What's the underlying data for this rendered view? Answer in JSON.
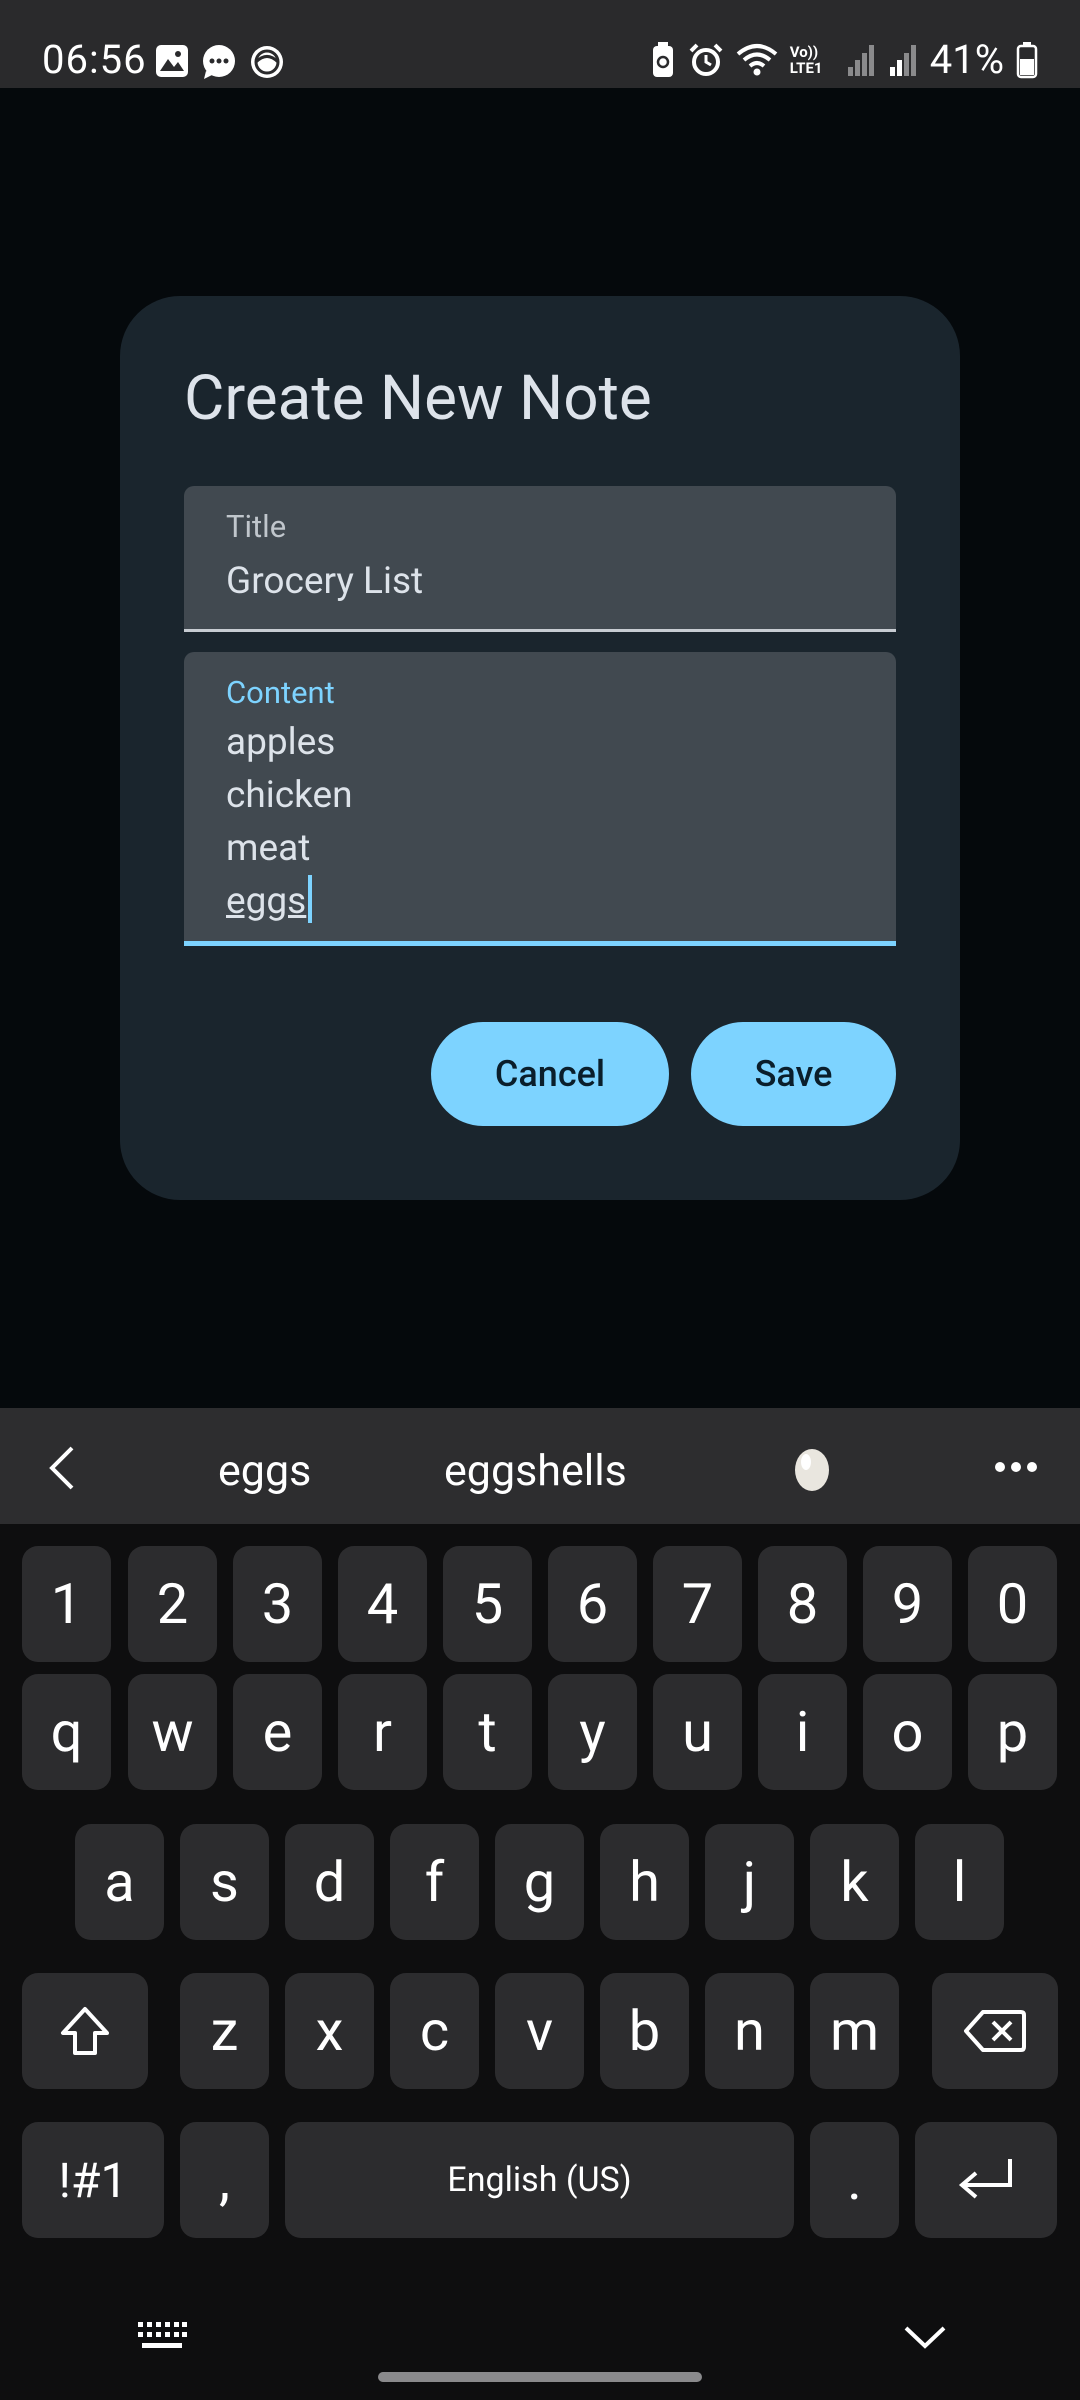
{
  "status_bar": {
    "time": "06:56",
    "left_icons": [
      "gallery-icon",
      "messages-icon",
      "browser-icon"
    ],
    "right_icons": [
      "battery-saver-icon",
      "alarm-icon",
      "wifi-icon",
      "volte-icon",
      "signal-icon",
      "signal-icon"
    ],
    "battery": "41%",
    "volte_label": "Vo)) LTE1"
  },
  "dialog": {
    "title": "Create New Note",
    "title_field": {
      "label": "Title",
      "value": "Grocery List"
    },
    "content_field": {
      "label": "Content",
      "lines": [
        "apples",
        "chicken",
        "meat",
        "eggs"
      ]
    },
    "cancel_label": "Cancel",
    "save_label": "Save"
  },
  "keyboard": {
    "suggestions": [
      "eggs",
      "eggshells"
    ],
    "suggestion_emoji": "egg-emoji",
    "row_numbers": [
      "1",
      "2",
      "3",
      "4",
      "5",
      "6",
      "7",
      "8",
      "9",
      "0"
    ],
    "row_1": [
      "q",
      "w",
      "e",
      "r",
      "t",
      "y",
      "u",
      "i",
      "o",
      "p"
    ],
    "row_2": [
      "a",
      "s",
      "d",
      "f",
      "g",
      "h",
      "j",
      "k",
      "l"
    ],
    "row_3": [
      "z",
      "x",
      "c",
      "v",
      "b",
      "n",
      "m"
    ],
    "symbols_label": "!#1",
    "comma_label": ",",
    "space_label": "English (US)",
    "period_label": "."
  },
  "colors": {
    "accent": "#7dd3ff",
    "dialog_bg": "#1a252d",
    "field_bg": "#414950",
    "key_bg": "#2c2c2e"
  }
}
